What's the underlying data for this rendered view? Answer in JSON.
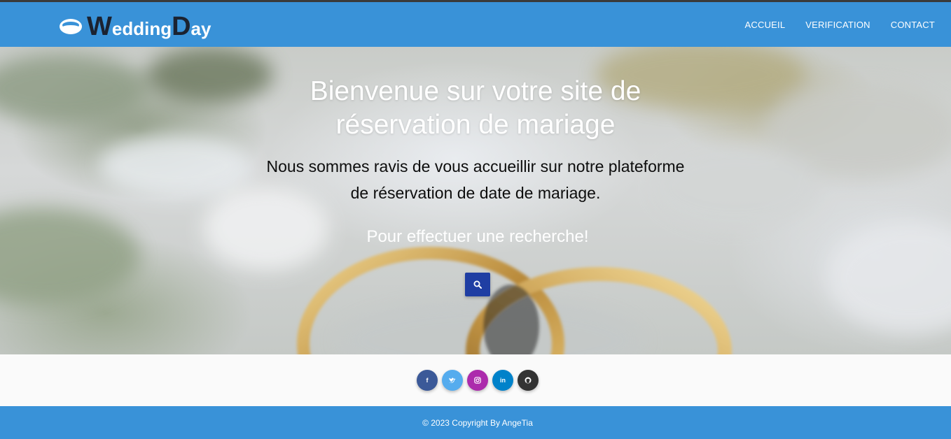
{
  "brand": {
    "letter1": "W",
    "part1": "edding",
    "letter2": "D",
    "part2": "ay"
  },
  "nav": {
    "items": [
      {
        "label": "ACCUEIL"
      },
      {
        "label": "VERIFICATION"
      },
      {
        "label": "CONTACT"
      }
    ]
  },
  "hero": {
    "title": "Bienvenue sur votre site de réservation de mariage",
    "subtitle": "Nous sommes ravis de vous accueillir sur notre plateforme de réservation de date de mariage.",
    "cta": "Pour effectuer une recherche!",
    "search_icon": "search-icon"
  },
  "social": {
    "items": [
      {
        "icon": "facebook-icon",
        "glyph": "f",
        "color": "#3b5998"
      },
      {
        "icon": "twitter-icon",
        "glyph": "🐦",
        "color": "#55acee"
      },
      {
        "icon": "instagram-icon",
        "glyph": "◎",
        "color": "#ac2bac"
      },
      {
        "icon": "linkedin-icon",
        "glyph": "in",
        "color": "#0082ca"
      },
      {
        "icon": "github-icon",
        "glyph": "●",
        "color": "#333333"
      }
    ]
  },
  "footer": {
    "copyright": "© 2023 Copyright By AngeTia"
  },
  "colors": {
    "primary": "#3992d8",
    "search_button": "#1f3ea3"
  }
}
